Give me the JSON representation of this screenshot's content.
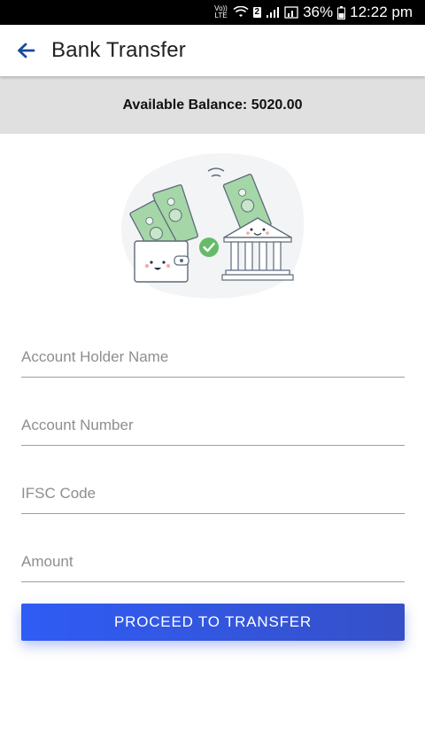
{
  "status_bar": {
    "volte_label": "Vo)) LTE",
    "sim_badge": "2",
    "battery": "36%",
    "time": "12:22 pm"
  },
  "app_bar": {
    "title": "Bank Transfer",
    "back_icon": "arrow-left-icon"
  },
  "balance": {
    "text": "Available Balance: 5020.00"
  },
  "illustration": {
    "name": "wallet-to-bank-transfer-illustration",
    "colors": {
      "money": "#a5d6a7",
      "check": "#66bb6a",
      "outline": "#5d6a7a",
      "blob": "#f3f4f6"
    }
  },
  "form": {
    "account_holder_placeholder": "Account Holder Name",
    "account_number_placeholder": "Account Number",
    "ifsc_placeholder": "IFSC Code",
    "amount_placeholder": "Amount"
  },
  "actions": {
    "proceed_label": "PROCEED TO TRANSFER"
  },
  "colors": {
    "accent": "#2f5cf5",
    "back_arrow": "#1a4a9a",
    "banner_bg": "#e0e0e0"
  }
}
